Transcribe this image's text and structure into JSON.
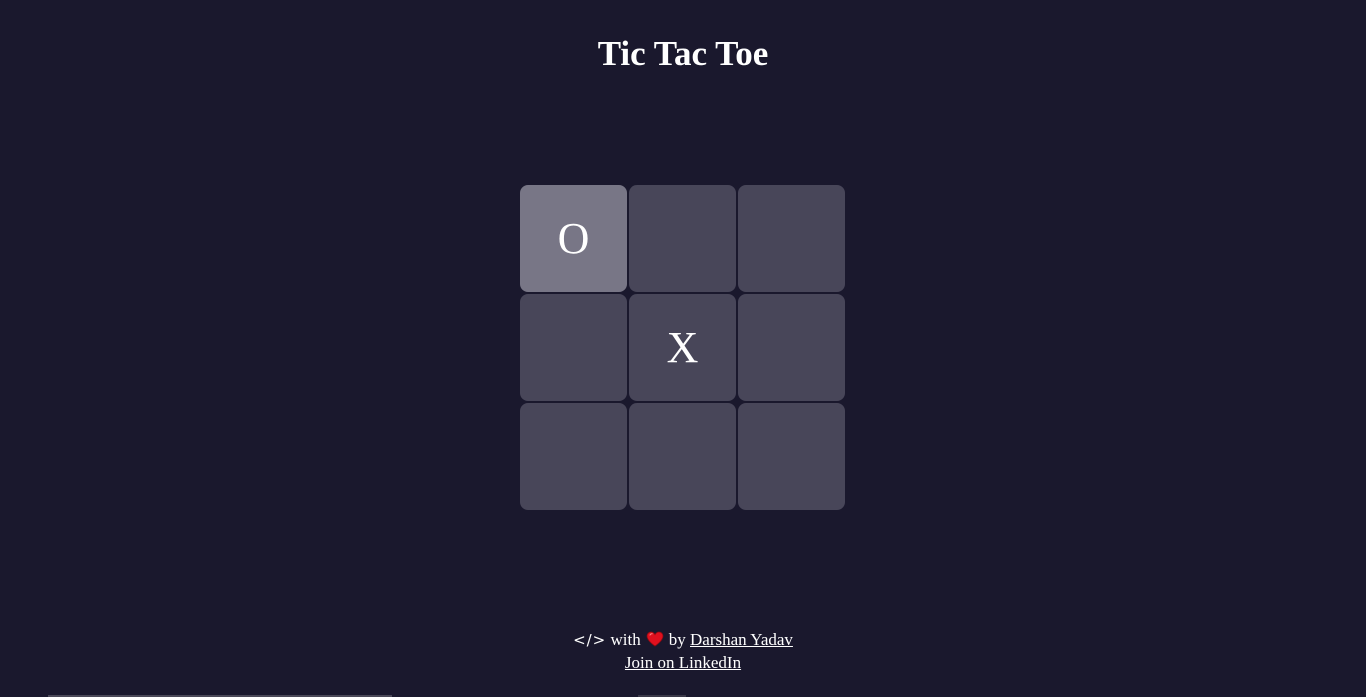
{
  "header": {
    "title": "Tic Tac Toe"
  },
  "board": {
    "cells": [
      "O",
      "",
      "",
      "",
      "X",
      "",
      "",
      "",
      ""
    ],
    "highlighted_index": 0
  },
  "footer": {
    "code_glyph": "</>",
    "with_text": "with",
    "heart_icon": "heart-icon",
    "by_text": "by",
    "author_link": "Darshan Yadav",
    "linkedin_link": "Join on LinkedIn"
  },
  "colors": {
    "background": "#1a182d",
    "cell": "#484659",
    "cell_highlight": "#787686",
    "heart": "#e0101e"
  }
}
